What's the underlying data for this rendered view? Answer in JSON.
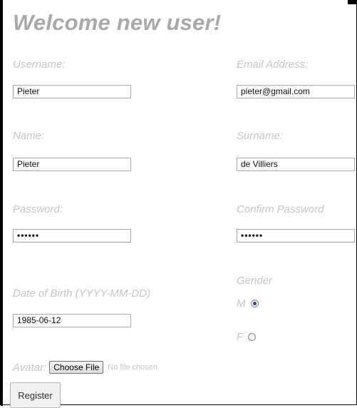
{
  "form": {
    "title": "Welcome new user!",
    "username": {
      "label": "Username:",
      "value": "Pieter"
    },
    "email": {
      "label": "Email Address:",
      "value": "pieter@gmail.com"
    },
    "name": {
      "label": "Name:",
      "value": "Pieter"
    },
    "surname": {
      "label": "Surname:",
      "value": "de Villiers"
    },
    "password": {
      "label": "Password:",
      "value": "••••••"
    },
    "confirm_password": {
      "label": "Confirm Password",
      "value": "••••••"
    },
    "dob": {
      "label": "Date of Birth (YYYY-MM-DD)",
      "value": "1985-06-12"
    },
    "gender": {
      "label": "Gender",
      "options": [
        {
          "label": "M",
          "checked": true
        },
        {
          "label": "F",
          "checked": false
        }
      ]
    },
    "avatar": {
      "label": "Avatar:",
      "button_label": "Choose File",
      "status": "No file chosen"
    },
    "register_label": "Register"
  },
  "colors": {
    "label": "#c6c6c6",
    "title": "#a9a9a9",
    "radio_checked": "#1d4fa3"
  }
}
